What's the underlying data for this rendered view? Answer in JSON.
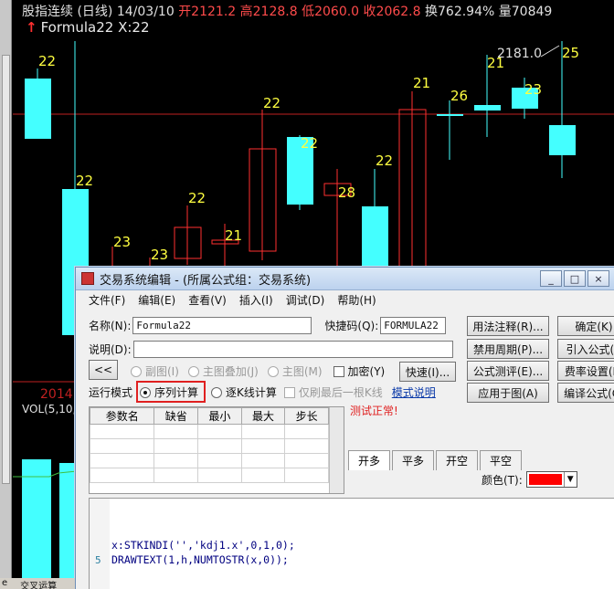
{
  "header": {
    "symbol": "股指连续",
    "period": "(日线)",
    "date": "14/03/10",
    "open": "开2121.2",
    "high": "高2128.8",
    "low": "低2060.0",
    "close": "收2062.8",
    "turnover": "换762.94%",
    "volume": "量70849"
  },
  "formula_line": {
    "arrow": "↑",
    "text": "Formula22  X:22"
  },
  "chart": {
    "peak_label": "2181.0",
    "year_label": "2014",
    "vol_label": "VOL(5,10,",
    "colors": {
      "up": "#ff3030",
      "down": "#44ffff",
      "label": "#ffff40",
      "axis": "#c02020"
    }
  },
  "dialog": {
    "title": "交易系统编辑 - (所属公式组：交易系统)",
    "window_controls": [
      "_",
      "□",
      "×"
    ],
    "menu": [
      "文件(F)",
      "编辑(E)",
      "查看(V)",
      "插入(I)",
      "调试(D)",
      "帮助(H)"
    ],
    "name_label": "名称(N):",
    "name_value": "Formula22",
    "shortcut_label": "快捷码(Q):",
    "shortcut_value": "FORMULA22",
    "desc_label": "说明(D):",
    "desc_value": "",
    "btn_usage": "用法注释(R)...",
    "btn_disable_period": "禁用周期(P)...",
    "btn_test": "公式测评(E)...",
    "btn_apply": "应用于图(A)",
    "btn_ok": "确定(K)",
    "btn_import": "引入公式(I)",
    "btn_fee": "费率设置(F)",
    "btn_compile": "编译公式(C)",
    "collapse_btn": "<<",
    "chk_subchart": "副图(I)",
    "chk_overlay": "主图叠加(J)",
    "chk_main": "主图(M)",
    "chk_encrypt": "加密(Y)",
    "btn_quick": "快速(I)...",
    "run_mode_label": "运行模式",
    "radio_sequence": "序列计算",
    "radio_kline": "逐K线计算",
    "chk_refresh_last": "仅刷最后一根K线",
    "mode_help_link": "模式说明",
    "status_text": "测试正常!",
    "param_headers": [
      "参数名",
      "缺省",
      "最小",
      "最大",
      "步长"
    ],
    "tabs": [
      "开多",
      "平多",
      "开空",
      "平空"
    ],
    "color_label": "颜色(T):",
    "swatch_color": "#ff0000",
    "code_lines": [
      {
        "num": "",
        "text": "x:STKINDI('','kdj1.x',0,1,0);"
      },
      {
        "num": "5",
        "text": "DRAWTEXT(1,h,NUMTOSTR(x,0));"
      }
    ]
  },
  "footer": {
    "left_text": "e",
    "tab_text": "交叉运算"
  }
}
